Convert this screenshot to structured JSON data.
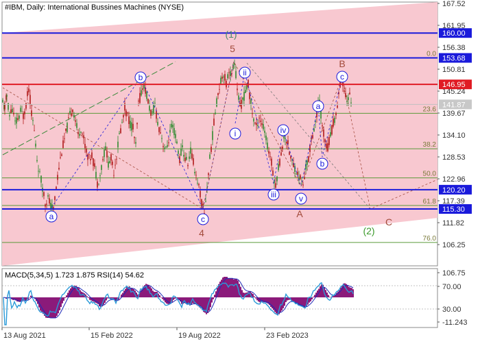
{
  "chart_data": {
    "type": "candlestick",
    "title": "#IBM, Daily:  International Bussines Machines (NYSE)",
    "x_labels": [
      "13 Aug 2021",
      "15 Feb 2022",
      "19 Aug 2022",
      "23 Feb 2023"
    ],
    "y_ticks": [
      "167.52",
      "161.95",
      "156.38",
      "150.81",
      "145.24",
      "139.67",
      "134.10",
      "128.53",
      "122.96",
      "117.39",
      "111.82",
      "106.25"
    ],
    "ylim": [
      101,
      169
    ],
    "price_line": {
      "value": 141.87,
      "label": "141.87"
    },
    "horizontal_levels": [
      {
        "value": 160.0,
        "label": "160.00",
        "color": "#1a1adb"
      },
      {
        "value": 153.68,
        "label": "153.68",
        "color": "#1a1adb"
      },
      {
        "value": 146.95,
        "label": "146.95",
        "color": "#e01b24"
      },
      {
        "value": 120.2,
        "label": "120.20",
        "color": "#1a1adb"
      },
      {
        "value": 115.3,
        "label": "115.30",
        "color": "#1a1adb"
      }
    ],
    "fibonacci": {
      "color": "#5a9a3a",
      "levels": [
        {
          "label": "0.0",
          "value": 153.68
        },
        {
          "label": "23.6",
          "value": 139.6
        },
        {
          "label": "38.2",
          "value": 130.6
        },
        {
          "label": "50.0",
          "value": 123.2
        },
        {
          "label": "61.8",
          "value": 116.2
        },
        {
          "label": "76.0",
          "value": 106.8
        }
      ]
    },
    "price_waypoints": [
      [
        0,
        142
      ],
      [
        3,
        141
      ],
      [
        6,
        144
      ],
      [
        10,
        139
      ],
      [
        14,
        141
      ],
      [
        18,
        137
      ],
      [
        22,
        138
      ],
      [
        26,
        140
      ],
      [
        30,
        139
      ],
      [
        34,
        142
      ],
      [
        38,
        146
      ],
      [
        42,
        140
      ],
      [
        46,
        135
      ],
      [
        50,
        128
      ],
      [
        54,
        124
      ],
      [
        58,
        121
      ],
      [
        62,
        117
      ],
      [
        66,
        118
      ],
      [
        70,
        116
      ],
      [
        74,
        115
      ],
      [
        78,
        121
      ],
      [
        82,
        126
      ],
      [
        86,
        130
      ],
      [
        90,
        133
      ],
      [
        94,
        136
      ],
      [
        98,
        139
      ],
      [
        102,
        141
      ],
      [
        106,
        138
      ],
      [
        110,
        134
      ],
      [
        114,
        136
      ],
      [
        118,
        133
      ],
      [
        122,
        130
      ],
      [
        126,
        128
      ],
      [
        130,
        129
      ],
      [
        134,
        126
      ],
      [
        138,
        122
      ],
      [
        142,
        124
      ],
      [
        146,
        128
      ],
      [
        150,
        131
      ],
      [
        154,
        127
      ],
      [
        158,
        128
      ],
      [
        162,
        125
      ],
      [
        166,
        129
      ],
      [
        170,
        134
      ],
      [
        174,
        137
      ],
      [
        178,
        141
      ],
      [
        182,
        139
      ],
      [
        186,
        137
      ],
      [
        190,
        136
      ],
      [
        194,
        131
      ],
      [
        198,
        142
      ],
      [
        202,
        145
      ],
      [
        206,
        147
      ],
      [
        210,
        144
      ],
      [
        214,
        141
      ],
      [
        218,
        139
      ],
      [
        222,
        142
      ],
      [
        226,
        137
      ],
      [
        230,
        135
      ],
      [
        234,
        132
      ],
      [
        238,
        130
      ],
      [
        242,
        133
      ],
      [
        246,
        136
      ],
      [
        250,
        135
      ],
      [
        254,
        132
      ],
      [
        258,
        128
      ],
      [
        262,
        131
      ],
      [
        266,
        128
      ],
      [
        270,
        127
      ],
      [
        274,
        130
      ],
      [
        278,
        127
      ],
      [
        282,
        124
      ],
      [
        286,
        121
      ],
      [
        290,
        117
      ],
      [
        294,
        114
      ],
      [
        298,
        121
      ],
      [
        302,
        128
      ],
      [
        306,
        134
      ],
      [
        310,
        140
      ],
      [
        314,
        145
      ],
      [
        318,
        148
      ],
      [
        322,
        150
      ],
      [
        326,
        147
      ],
      [
        330,
        151
      ],
      [
        334,
        149
      ],
      [
        338,
        153
      ],
      [
        342,
        146
      ],
      [
        346,
        141
      ],
      [
        350,
        143
      ],
      [
        354,
        145
      ],
      [
        358,
        147
      ],
      [
        362,
        142
      ],
      [
        366,
        138
      ],
      [
        370,
        136
      ],
      [
        374,
        139
      ],
      [
        378,
        137
      ],
      [
        382,
        135
      ],
      [
        386,
        131
      ],
      [
        390,
        129
      ],
      [
        394,
        125
      ],
      [
        398,
        121
      ],
      [
        402,
        126
      ],
      [
        406,
        129
      ],
      [
        410,
        134
      ],
      [
        414,
        133
      ],
      [
        418,
        130
      ],
      [
        422,
        127
      ],
      [
        426,
        126
      ],
      [
        430,
        124
      ],
      [
        434,
        123
      ],
      [
        438,
        121
      ],
      [
        442,
        126
      ],
      [
        446,
        128
      ],
      [
        450,
        133
      ],
      [
        454,
        136
      ],
      [
        458,
        139
      ],
      [
        462,
        143
      ],
      [
        466,
        136
      ],
      [
        470,
        133
      ],
      [
        474,
        131
      ],
      [
        478,
        134
      ],
      [
        482,
        137
      ],
      [
        486,
        139
      ],
      [
        490,
        145
      ],
      [
        494,
        148
      ],
      [
        498,
        146
      ],
      [
        502,
        143
      ],
      [
        506,
        144
      ],
      [
        510,
        142
      ]
    ],
    "wave_labels": [
      {
        "text": "a",
        "circled": true,
        "color": "#1a1adb",
        "x": 75,
        "y": 316
      },
      {
        "text": "b",
        "circled": true,
        "color": "#1a1adb",
        "x": 205,
        "y": 113
      },
      {
        "text": "c",
        "circled": true,
        "color": "#1a1adb",
        "x": 296,
        "y": 320
      },
      {
        "text": "ii",
        "circled": true,
        "color": "#1a1adb",
        "x": 357,
        "y": 106
      },
      {
        "text": "i",
        "circled": true,
        "color": "#1a1adb",
        "x": 343,
        "y": 195
      },
      {
        "text": "iii",
        "circled": true,
        "color": "#1a1adb",
        "x": 399,
        "y": 284
      },
      {
        "text": "iv",
        "circled": true,
        "color": "#1a1adb",
        "x": 413,
        "y": 190
      },
      {
        "text": "v",
        "circled": true,
        "color": "#1a1adb",
        "x": 439,
        "y": 290
      },
      {
        "text": "a",
        "circled": true,
        "color": "#1a1adb",
        "x": 464,
        "y": 155
      },
      {
        "text": "b",
        "circled": true,
        "color": "#1a1adb",
        "x": 470,
        "y": 239
      },
      {
        "text": "c",
        "circled": true,
        "color": "#1a1adb",
        "x": 499,
        "y": 112
      },
      {
        "text": "(1)",
        "circled": false,
        "color": "#4a8a6a",
        "x": 337,
        "y": 50
      },
      {
        "text": "5",
        "circled": false,
        "color": "#a24a3a",
        "x": 339,
        "y": 71
      },
      {
        "text": "4",
        "circled": false,
        "color": "#a24a3a",
        "x": 294,
        "y": 340
      },
      {
        "text": "A",
        "circled": false,
        "color": "#a24a3a",
        "x": 437,
        "y": 312
      },
      {
        "text": "B",
        "circled": false,
        "color": "#a24a3a",
        "x": 499,
        "y": 93
      },
      {
        "text": "C",
        "circled": false,
        "color": "#a24a3a",
        "x": 567,
        "y": 324
      },
      {
        "text": "(2)",
        "circled": false,
        "color": "#3a9a2a",
        "x": 538,
        "y": 337
      }
    ],
    "macd_panel": {
      "title": "MACD(5,34,5) 1.723 1.875 RSI(14) 54.62",
      "y_ticks": [
        "106.75",
        "70.00",
        "30.00",
        "-11.243"
      ]
    }
  }
}
